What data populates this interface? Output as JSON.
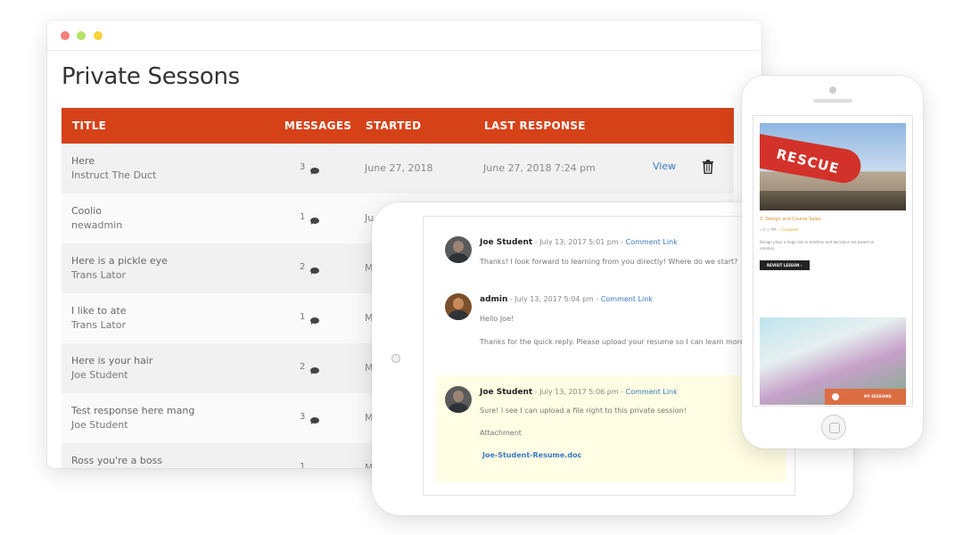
{
  "desktop": {
    "page_title": "Private Sessons",
    "columns": [
      "TITLE",
      "MESSAGES",
      "STARTED",
      "LAST RESPONSE"
    ],
    "first_row_action": "View",
    "rows": [
      {
        "title": "Here",
        "subtitle": "Instruct The Duct",
        "count": "3",
        "started": "June 27, 2018",
        "last": "June 27, 2018 7:24 pm"
      },
      {
        "title": "Coolio",
        "subtitle": "newadmin",
        "count": "1",
        "started": "Ju",
        "last": ""
      },
      {
        "title": "Here is a pickle eye",
        "subtitle": "Trans Lator",
        "count": "2",
        "started": "M",
        "last": ""
      },
      {
        "title": "I like to ate",
        "subtitle": "Trans Lator",
        "count": "1",
        "started": "M",
        "last": ""
      },
      {
        "title": "Here is your hair",
        "subtitle": "Joe Student",
        "count": "2",
        "started": "M",
        "last": ""
      },
      {
        "title": "Test response here mang",
        "subtitle": "Joe Student",
        "count": "3",
        "started": "M",
        "last": ""
      },
      {
        "title": "Ross you're a boss",
        "subtitle": "",
        "count": "1",
        "started": "M",
        "last": ""
      }
    ],
    "icons": {
      "message": "speech-bubble-icon",
      "delete": "trash-icon"
    },
    "colors": {
      "header": "#d64218",
      "link": "#3a79c2"
    }
  },
  "tablet": {
    "comments": [
      {
        "author": "Joe Student",
        "meta": " - July 13, 2017 5:01 pm - ",
        "link": "Comment Link",
        "lines": [
          "Thanks! I look forward to learning from you directly! Where do we start?"
        ]
      },
      {
        "author": "admin",
        "meta": " - July 13, 2017 5:04 pm - ",
        "link": "Comment Link",
        "lines": [
          "Hello Joe!",
          "Thanks for the quick reply. Please upload your resume so I can learn more ab"
        ]
      },
      {
        "author": "Joe Student",
        "meta": " - July 13, 2017 5:06 pm - ",
        "link": "Comment Link",
        "lines": [
          "Sure! I see I can upload a file right to this private session!",
          "Attachment"
        ],
        "attachment": "Joe-Student-Resume.doc"
      }
    ],
    "colors": {
      "highlight": "#fffde3"
    }
  },
  "phone": {
    "boat_text": "RESCUE",
    "lesson_title": "2. Design and Course Sales",
    "meta_1": "0",
    "meta_2": "PM",
    "status": "Complete",
    "desc_1": "Design plays a huge role in emotion and decisions are based on",
    "desc_2": "emotion.",
    "button": "REVISIT LESSON",
    "bar_label": "MY SESSIONS",
    "colors": {
      "accent": "#e08a2a",
      "bar": "#e06a3e"
    }
  }
}
